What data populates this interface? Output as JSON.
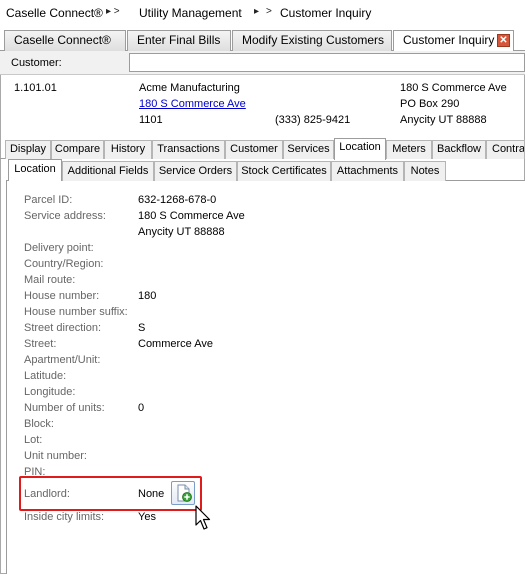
{
  "breadcrumb": {
    "items": [
      "Caselle Connect®",
      "Utility Management",
      "Customer Inquiry"
    ],
    "separators": [
      "▸ >",
      "▸",
      ">"
    ]
  },
  "doc_tabs": [
    {
      "label": "Caselle Connect®"
    },
    {
      "label": "Enter Final Bills"
    },
    {
      "label": "Modify Existing Customers"
    },
    {
      "label": "Customer Inquiry"
    }
  ],
  "customer": {
    "label": "Customer:",
    "value": ""
  },
  "account": {
    "number": "1.101.01",
    "name": "Acme Manufacturing",
    "service_address_link": "180 S Commerce Ave",
    "address_number": "1101",
    "phone": "(333) 825-9421",
    "mailing_line1": "180 S Commerce Ave",
    "mailing_line2": "PO Box 290",
    "mailing_line3": "Anycity  UT  88888"
  },
  "detail_tabs": [
    "Display",
    "Compare",
    "History",
    "Transactions",
    "Customer",
    "Services",
    "Location",
    "Meters",
    "Backflow",
    "Contracts"
  ],
  "sub_tabs": [
    "Location",
    "Additional Fields",
    "Service Orders",
    "Stock Certificates",
    "Attachments",
    "Notes"
  ],
  "fields": {
    "parcel_id": {
      "label": "Parcel ID:",
      "value": "632-1268-678-0"
    },
    "service_address": {
      "label": "Service address:",
      "value": "180 S Commerce Ave",
      "value2": "Anycity  UT  88888"
    },
    "delivery_point": {
      "label": "Delivery point:",
      "value": ""
    },
    "country_region": {
      "label": "Country/Region:",
      "value": ""
    },
    "mail_route": {
      "label": "Mail route:",
      "value": ""
    },
    "house_number": {
      "label": "House number:",
      "value": "180"
    },
    "house_number_suffix": {
      "label": "House number suffix:",
      "value": ""
    },
    "street_direction": {
      "label": "Street direction:",
      "value": "S"
    },
    "street": {
      "label": "Street:",
      "value": "Commerce Ave"
    },
    "apartment_unit": {
      "label": "Apartment/Unit:",
      "value": ""
    },
    "latitude": {
      "label": "Latitude:",
      "value": ""
    },
    "longitude": {
      "label": "Longitude:",
      "value": ""
    },
    "number_of_units": {
      "label": "Number of units:",
      "value": "0"
    },
    "block": {
      "label": "Block:",
      "value": ""
    },
    "lot": {
      "label": "Lot:",
      "value": ""
    },
    "unit_number": {
      "label": "Unit number:",
      "value": ""
    },
    "pin": {
      "label": "PIN:",
      "value": ""
    },
    "landlord": {
      "label": "Landlord:",
      "value": "None"
    },
    "inside_city_limits": {
      "label": "Inside city limits:",
      "value": "Yes"
    }
  },
  "colors": {
    "highlight": "#e01b1b",
    "link": "#0000cc",
    "close_button": "#d5573b"
  },
  "icons": {
    "add_landlord": "add-document-icon",
    "close_tab": "close-icon",
    "cursor": "mouse-pointer-icon"
  }
}
